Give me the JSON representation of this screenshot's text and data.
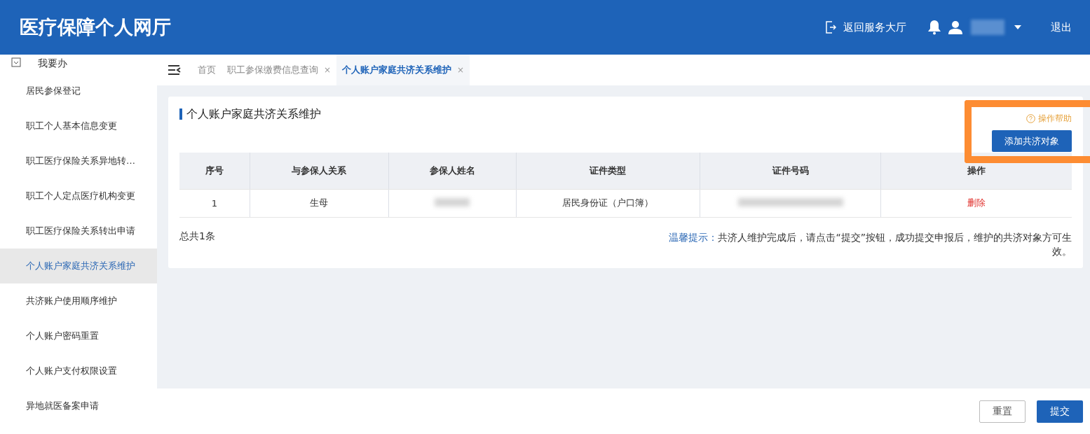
{
  "header": {
    "title": "医疗保障个人网厅",
    "back_link": "返回服务大厅",
    "logout": "退出"
  },
  "sidebar": {
    "group": "我要办",
    "items": [
      {
        "label": "居民参保登记",
        "selected": false
      },
      {
        "label": "职工个人基本信息变更",
        "selected": false
      },
      {
        "label": "职工医疗保险关系异地转…",
        "selected": false
      },
      {
        "label": "职工个人定点医疗机构变更",
        "selected": false
      },
      {
        "label": "职工医疗保险关系转出申请",
        "selected": false
      },
      {
        "label": "个人账户家庭共济关系维护",
        "selected": true
      },
      {
        "label": "共济账户使用顺序维护",
        "selected": false
      },
      {
        "label": "个人账户密码重置",
        "selected": false
      },
      {
        "label": "个人账户支付权限设置",
        "selected": false
      },
      {
        "label": "异地就医备案申请",
        "selected": false
      }
    ]
  },
  "tabs": [
    {
      "label": "首页",
      "selected": false
    },
    {
      "label": "职工参保缴费信息查询",
      "selected": false,
      "close": "×"
    },
    {
      "label": "个人账户家庭共济关系维护",
      "selected": true,
      "close": "×"
    }
  ],
  "panel": {
    "title": "个人账户家庭共济关系维护",
    "help": "操作帮助",
    "add_button": "添加共济对象",
    "table": {
      "columns": [
        "序号",
        "与参保人关系",
        "参保人姓名",
        "证件类型",
        "证件号码",
        "操作"
      ],
      "rows": [
        {
          "index": "1",
          "relation": "生母",
          "id_type": "居民身份证（户口簿）",
          "action": "删除"
        }
      ]
    },
    "total": "总共1条",
    "tip_label": "温馨提示：",
    "tip": "共济人维护完成后，请点击“提交”按钮，成功提交申报后，维护的共济对象方可生效。"
  },
  "footer": {
    "buttons": [
      {
        "label": "重置",
        "kind": "secondary"
      },
      {
        "label": "提交",
        "kind": "primary"
      }
    ]
  }
}
